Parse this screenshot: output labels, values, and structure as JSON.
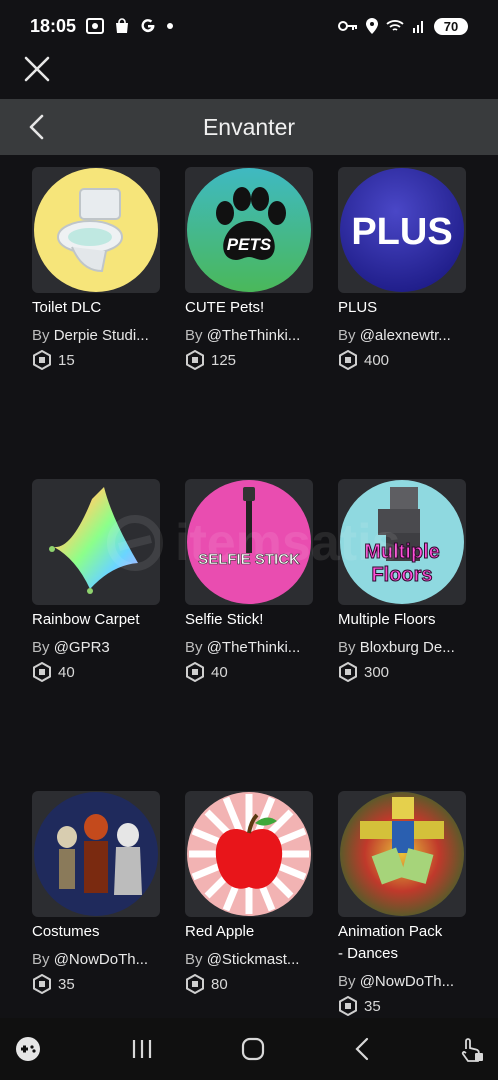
{
  "status": {
    "time": "18:05",
    "battery": "70"
  },
  "header": {
    "title": "Envanter"
  },
  "watermark": {
    "text": "itemsatis"
  },
  "items": [
    {
      "name": "Toilet DLC",
      "by": "By",
      "creator": "Derpie Studi...",
      "price": "15",
      "thumb": "toilet"
    },
    {
      "name": "CUTE Pets!",
      "by": "By",
      "creator": "@TheThinki...",
      "price": "125",
      "thumb": "pets",
      "thumb_text": "PETS"
    },
    {
      "name": "PLUS",
      "by": "By",
      "creator": "@alexnewtr...",
      "price": "400",
      "thumb": "plus",
      "thumb_text": "PLUS"
    },
    {
      "name": "Rainbow Carpet",
      "by": "By",
      "creator": "@GPR3",
      "price": "40",
      "thumb": "carpet"
    },
    {
      "name": "Selfie Stick!",
      "by": "By",
      "creator": "@TheThinki...",
      "price": "40",
      "thumb": "selfie",
      "thumb_text": "SELFIE STICK"
    },
    {
      "name": "Multiple Floors",
      "by": "By",
      "creator": "Bloxburg De...",
      "price": "300",
      "thumb": "floors",
      "thumb_text": "Multiple\nFloors"
    },
    {
      "name": "Costumes",
      "by": "By",
      "creator": "@NowDoTh...",
      "price": "35",
      "thumb": "costumes"
    },
    {
      "name": "Red Apple",
      "by": "By",
      "creator": "@Stickmast...",
      "price": "80",
      "thumb": "apple"
    },
    {
      "name": "Animation Pack\n- Dances",
      "by": "By",
      "creator": "@NowDoTh...",
      "price": "35",
      "thumb": "dance"
    }
  ],
  "colors": {
    "background": "#121215",
    "header": "#393b3d",
    "card": "#2c2d31"
  },
  "icons": [
    "close-icon",
    "back-icon",
    "robux-icon",
    "gamepad-icon",
    "recent-apps-icon",
    "home-icon",
    "nav-back-icon",
    "accessibility-icon"
  ]
}
